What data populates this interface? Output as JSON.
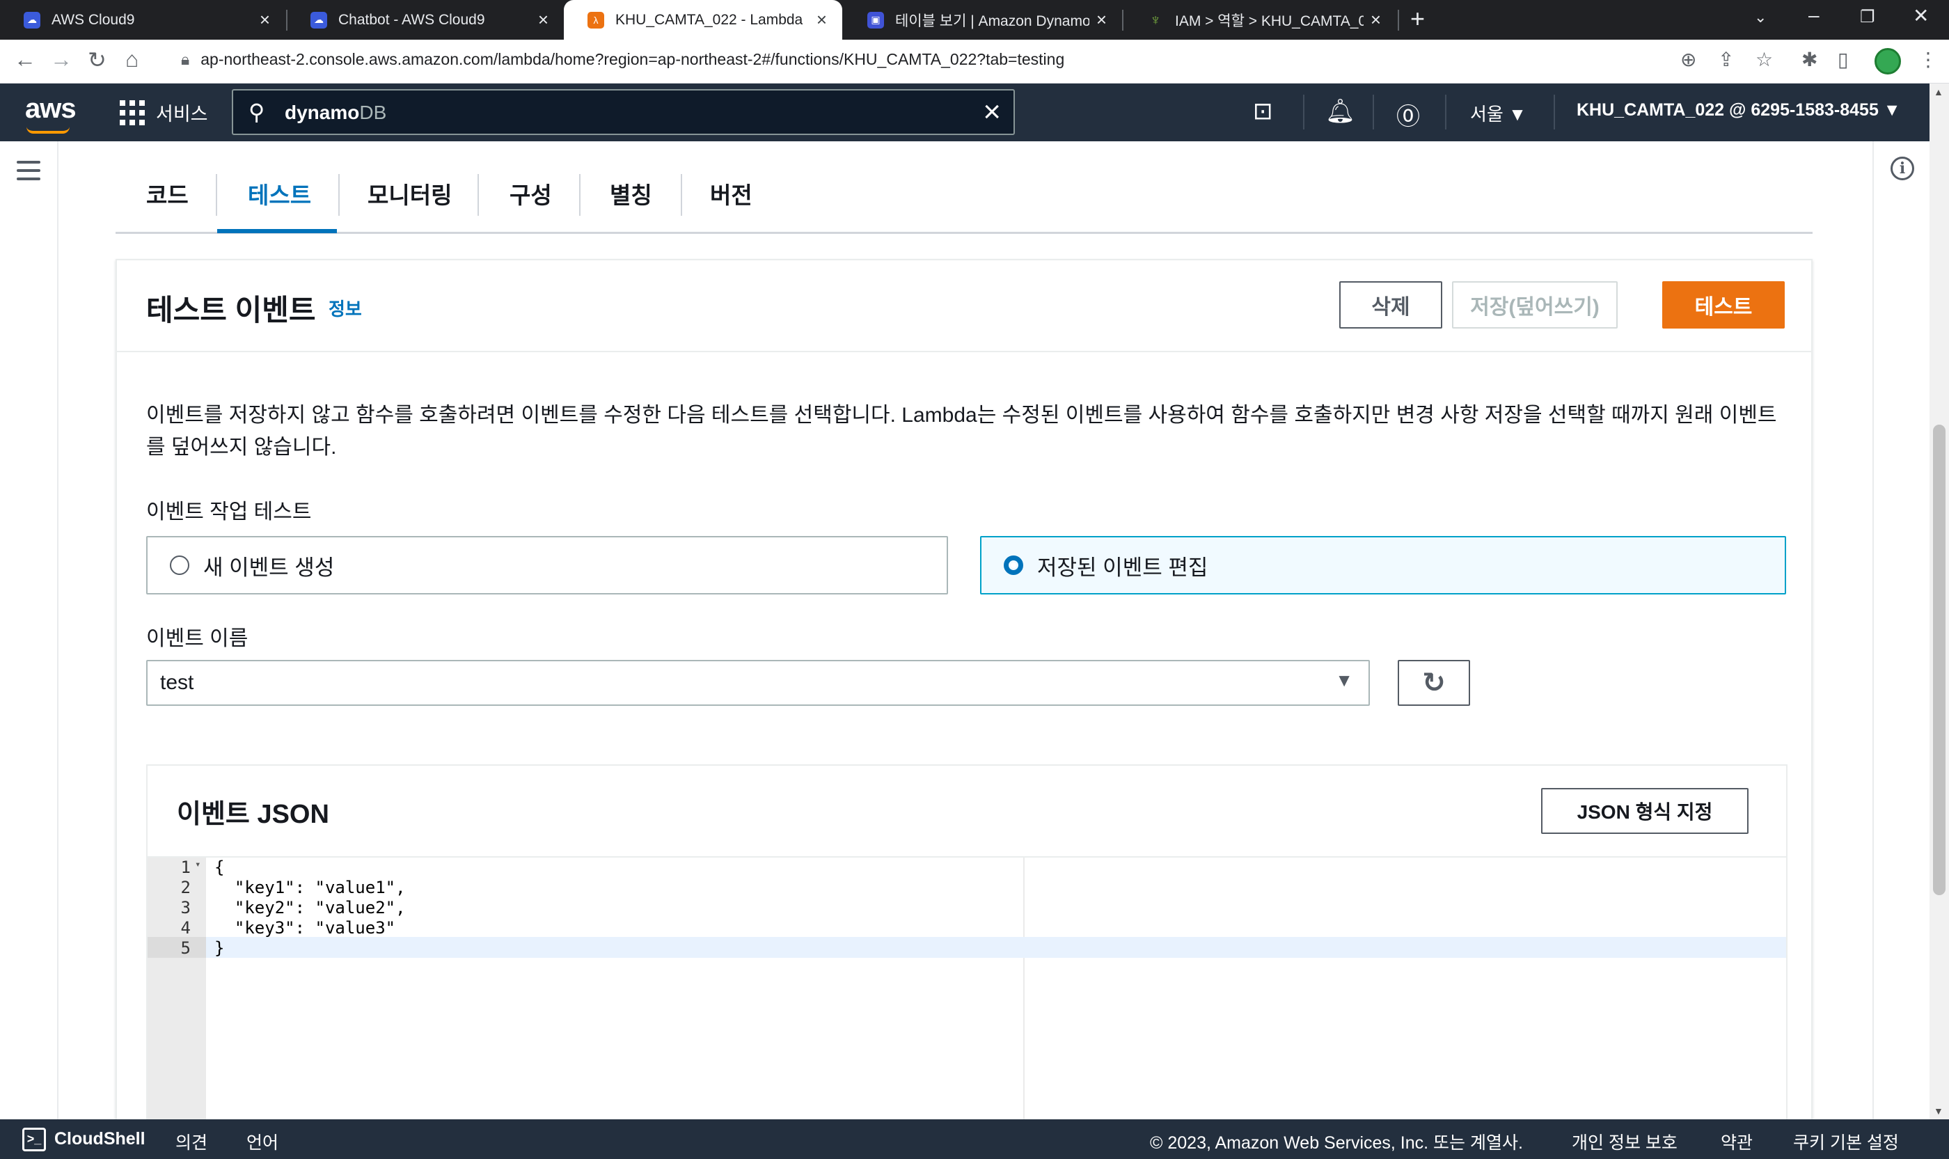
{
  "browser": {
    "tabs": [
      {
        "label": "AWS Cloud9",
        "active": false
      },
      {
        "label": "Chatbot - AWS Cloud9",
        "active": false
      },
      {
        "label": "KHU_CAMTA_022 - Lambda",
        "active": true
      },
      {
        "label": "테이블 보기 | Amazon DynamoDB",
        "active": false
      },
      {
        "label": "IAM > 역할 > KHU_CAMTA_022",
        "active": false
      }
    ],
    "url": "ap-northeast-2.console.aws.amazon.com/lambda/home?region=ap-northeast-2#/functions/KHU_CAMTA_022?tab=testing"
  },
  "aws_nav": {
    "logo": "aws",
    "services_label": "서비스",
    "search_value": "dynamo",
    "search_value_rest": "DB",
    "region": "서울 ▼",
    "account": "KHU_CAMTA_022 @ 6295-1583-8455 ▼"
  },
  "main_tabs": [
    {
      "label": "코드",
      "active": false
    },
    {
      "label": "테스트",
      "active": true
    },
    {
      "label": "모니터링",
      "active": false
    },
    {
      "label": "구성",
      "active": false
    },
    {
      "label": "별칭",
      "active": false
    },
    {
      "label": "버전",
      "active": false
    }
  ],
  "test_event": {
    "title": "테스트 이벤트",
    "info_link": "정보",
    "delete_button": "삭제",
    "save_button": "저장(덮어쓰기)",
    "test_button": "테스트",
    "description": "이벤트를 저장하지 않고 함수를 호출하려면 이벤트를 수정한 다음 테스트를 선택합니다. Lambda는 수정된 이벤트를 사용하여 함수를 호출하지만 변경 사항 저장을 선택할 때까지 원래 이벤트를 덮어쓰지 않습니다.",
    "action_label": "이벤트 작업 테스트",
    "option_new": "새 이벤트 생성",
    "option_edit": "저장된 이벤트 편집",
    "selected_option": "edit",
    "name_label": "이벤트 이름",
    "name_value": "test"
  },
  "json_panel": {
    "title": "이벤트 JSON",
    "format_button": "JSON 형식 지정",
    "line_numbers": [
      "1",
      "2",
      "3",
      "4",
      "5"
    ],
    "lines": [
      "{",
      "  \"key1\": \"value1\",",
      "  \"key2\": \"value2\",",
      "  \"key3\": \"value3\"",
      "}"
    ]
  },
  "footer": {
    "cloudshell": "CloudShell",
    "feedback": "의견",
    "language": "언어",
    "copyright": "© 2023, Amazon Web Services, Inc. 또는 계열사.",
    "privacy": "개인 정보 보호",
    "terms": "약관",
    "cookies": "쿠키 기본 설정"
  },
  "colors": {
    "aws_nav_bg": "#232f3e",
    "accent_orange": "#ec7211",
    "link_blue": "#0073bb"
  }
}
